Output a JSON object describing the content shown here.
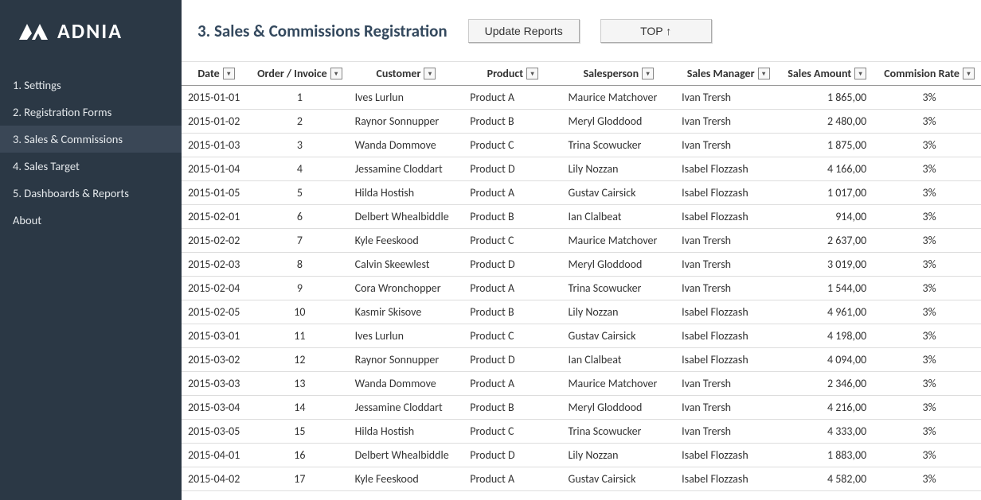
{
  "brand": {
    "name": "ADNIA"
  },
  "sidebar": {
    "items": [
      {
        "label": "1. Settings"
      },
      {
        "label": "2. Registration Forms"
      },
      {
        "label": "3. Sales & Commissions"
      },
      {
        "label": "4. Sales Target"
      },
      {
        "label": "5. Dashboards & Reports"
      },
      {
        "label": "About"
      }
    ],
    "activeIndex": 2
  },
  "header": {
    "title": "3. Sales & Commissions Registration",
    "buttons": {
      "update": "Update Reports",
      "top": "TOP ↑"
    }
  },
  "table": {
    "columns": [
      {
        "key": "date",
        "label": "Date"
      },
      {
        "key": "order",
        "label": "Order / Invoice"
      },
      {
        "key": "customer",
        "label": "Customer"
      },
      {
        "key": "product",
        "label": "Product"
      },
      {
        "key": "salesperson",
        "label": "Salesperson"
      },
      {
        "key": "manager",
        "label": "Sales Manager"
      },
      {
        "key": "amount",
        "label": "Sales Amount"
      },
      {
        "key": "rate",
        "label": "Commision Rate"
      }
    ],
    "rows": [
      {
        "date": "2015-01-01",
        "order": "1",
        "customer": "Ives Lurlun",
        "product": "Product A",
        "salesperson": "Maurice Matchover",
        "manager": "Ivan Trersh",
        "amount": "1 865,00",
        "rate": "3%"
      },
      {
        "date": "2015-01-02",
        "order": "2",
        "customer": "Raynor Sonnupper",
        "product": "Product B",
        "salesperson": "Meryl Gloddood",
        "manager": "Ivan Trersh",
        "amount": "2 480,00",
        "rate": "3%"
      },
      {
        "date": "2015-01-03",
        "order": "3",
        "customer": "Wanda Dommove",
        "product": "Product C",
        "salesperson": "Trina Scowucker",
        "manager": "Ivan Trersh",
        "amount": "1 875,00",
        "rate": "3%"
      },
      {
        "date": "2015-01-04",
        "order": "4",
        "customer": "Jessamine Cloddart",
        "product": "Product D",
        "salesperson": "Lily Nozzan",
        "manager": "Isabel Flozzash",
        "amount": "4 166,00",
        "rate": "3%"
      },
      {
        "date": "2015-01-05",
        "order": "5",
        "customer": "Hilda Hostish",
        "product": "Product A",
        "salesperson": "Gustav Cairsick",
        "manager": "Isabel Flozzash",
        "amount": "1 017,00",
        "rate": "3%"
      },
      {
        "date": "2015-02-01",
        "order": "6",
        "customer": "Delbert Whealbiddle",
        "product": "Product B",
        "salesperson": "Ian Clalbeat",
        "manager": "Isabel Flozzash",
        "amount": "914,00",
        "rate": "3%"
      },
      {
        "date": "2015-02-02",
        "order": "7",
        "customer": "Kyle Feeskood",
        "product": "Product C",
        "salesperson": "Maurice Matchover",
        "manager": "Ivan Trersh",
        "amount": "2 637,00",
        "rate": "3%"
      },
      {
        "date": "2015-02-03",
        "order": "8",
        "customer": "Calvin Skeewlest",
        "product": "Product D",
        "salesperson": "Meryl Gloddood",
        "manager": "Ivan Trersh",
        "amount": "3 019,00",
        "rate": "3%"
      },
      {
        "date": "2015-02-04",
        "order": "9",
        "customer": "Cora Wronchopper",
        "product": "Product A",
        "salesperson": "Trina Scowucker",
        "manager": "Ivan Trersh",
        "amount": "1 544,00",
        "rate": "3%"
      },
      {
        "date": "2015-02-05",
        "order": "10",
        "customer": "Kasmir Skisove",
        "product": "Product B",
        "salesperson": "Lily Nozzan",
        "manager": "Isabel Flozzash",
        "amount": "4 961,00",
        "rate": "3%"
      },
      {
        "date": "2015-03-01",
        "order": "11",
        "customer": "Ives Lurlun",
        "product": "Product C",
        "salesperson": "Gustav Cairsick",
        "manager": "Isabel Flozzash",
        "amount": "4 198,00",
        "rate": "3%"
      },
      {
        "date": "2015-03-02",
        "order": "12",
        "customer": "Raynor Sonnupper",
        "product": "Product D",
        "salesperson": "Ian Clalbeat",
        "manager": "Isabel Flozzash",
        "amount": "4 094,00",
        "rate": "3%"
      },
      {
        "date": "2015-03-03",
        "order": "13",
        "customer": "Wanda Dommove",
        "product": "Product A",
        "salesperson": "Maurice Matchover",
        "manager": "Ivan Trersh",
        "amount": "2 346,00",
        "rate": "3%"
      },
      {
        "date": "2015-03-04",
        "order": "14",
        "customer": "Jessamine Cloddart",
        "product": "Product B",
        "salesperson": "Meryl Gloddood",
        "manager": "Ivan Trersh",
        "amount": "4 216,00",
        "rate": "3%"
      },
      {
        "date": "2015-03-05",
        "order": "15",
        "customer": "Hilda Hostish",
        "product": "Product C",
        "salesperson": "Trina Scowucker",
        "manager": "Ivan Trersh",
        "amount": "4 333,00",
        "rate": "3%"
      },
      {
        "date": "2015-04-01",
        "order": "16",
        "customer": "Delbert Whealbiddle",
        "product": "Product D",
        "salesperson": "Lily Nozzan",
        "manager": "Isabel Flozzash",
        "amount": "1 883,00",
        "rate": "3%"
      },
      {
        "date": "2015-04-02",
        "order": "17",
        "customer": "Kyle Feeskood",
        "product": "Product A",
        "salesperson": "Gustav Cairsick",
        "manager": "Isabel Flozzash",
        "amount": "4 582,00",
        "rate": "3%"
      }
    ]
  }
}
